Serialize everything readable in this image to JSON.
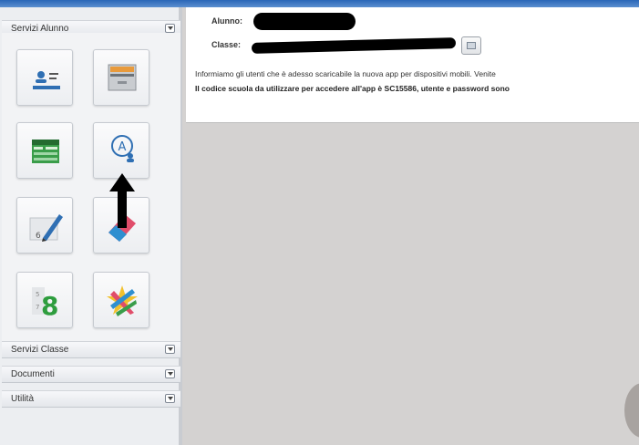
{
  "sidebar": {
    "sections": [
      {
        "label": "Servizi Alunno"
      },
      {
        "label": "Servizi Classe"
      },
      {
        "label": "Documenti"
      },
      {
        "label": "Utilità"
      }
    ],
    "tiles": [
      {
        "icon": "student-card-icon"
      },
      {
        "icon": "file-drawer-icon"
      },
      {
        "icon": "schedule-table-icon"
      },
      {
        "icon": "absence-user-icon"
      },
      {
        "icon": "pencil-grades-icon"
      },
      {
        "icon": "eraser-notes-icon"
      },
      {
        "icon": "number-eight-icon"
      },
      {
        "icon": "colorful-stars-icon"
      }
    ]
  },
  "student": {
    "alunno_label": "Alunno:",
    "classe_label": "Classe:"
  },
  "notice": {
    "line1": "Informiamo gli utenti che è adesso scaricabile la nuova app per dispositivi mobili. Venite",
    "line2": "Il codice scuola da utilizzare per accedere all'app è SC15586, utente e password sono"
  },
  "colors": {
    "accent": "#2a66b8",
    "sidebar_bg": "#eceef1",
    "content_bg": "#d4d2d1"
  }
}
